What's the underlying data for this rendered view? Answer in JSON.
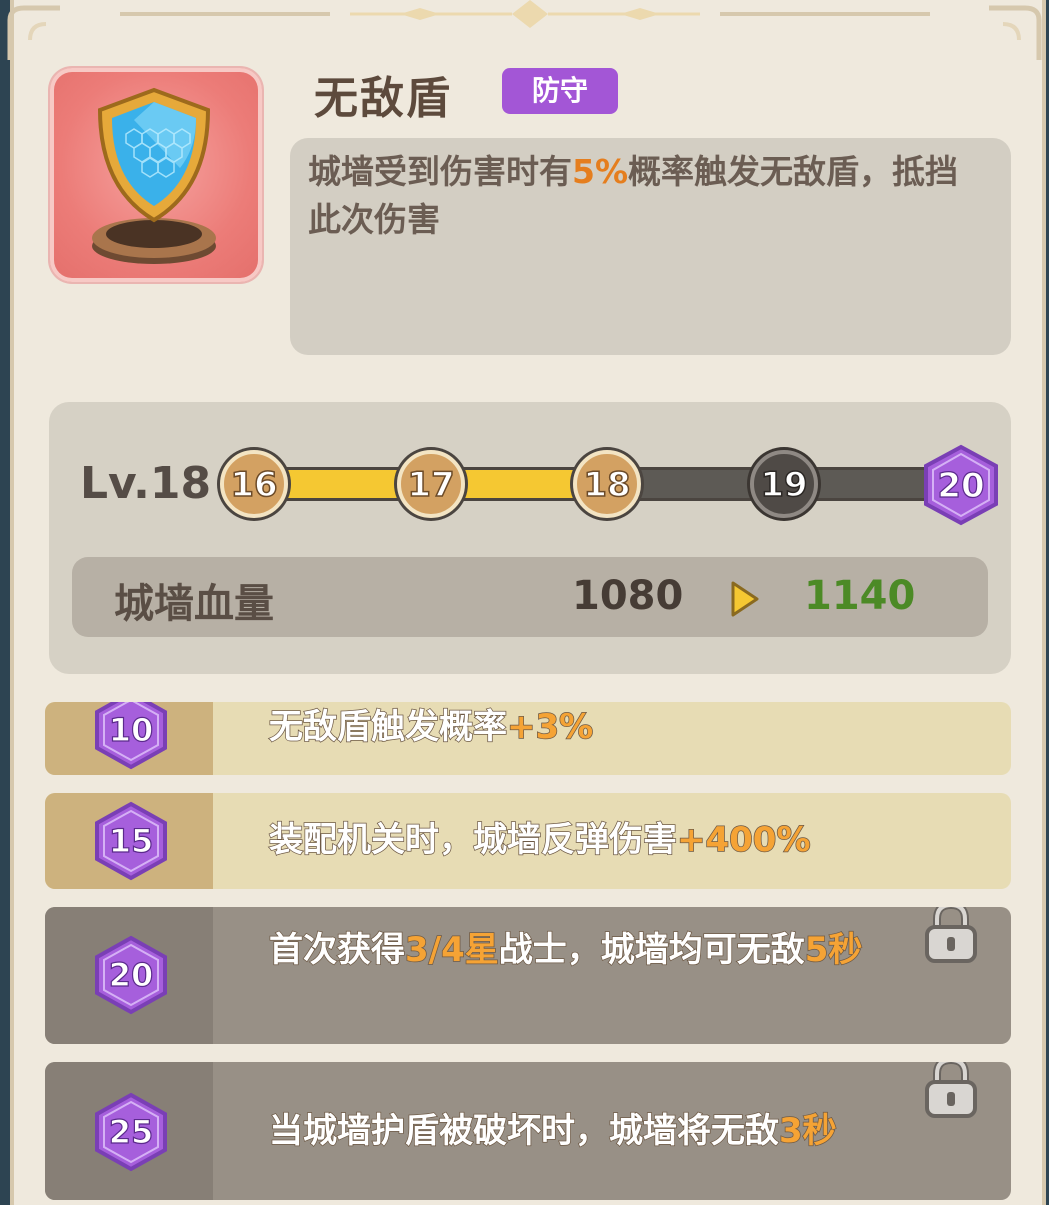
{
  "skill": {
    "name": "无敌盾",
    "tag": "防守",
    "desc_pre": "城墙受到伤害时有",
    "desc_hl": "5%",
    "desc_post": "概率触发无敌盾，抵挡此次伤害"
  },
  "level": {
    "label": "Lv.18",
    "progress": 18,
    "nodes": [
      {
        "label": "16",
        "state": "done"
      },
      {
        "label": "17",
        "state": "done"
      },
      {
        "label": "18",
        "state": "done"
      },
      {
        "label": "19",
        "state": "locked"
      },
      {
        "label": "20",
        "state": "milestone"
      }
    ]
  },
  "stat": {
    "name": "城墙血量",
    "current": "1080",
    "next": "1140"
  },
  "upgrades": [
    {
      "level": "10",
      "pre": "无敌盾触发概率",
      "hl": "+3%",
      "post": "",
      "hl2": "",
      "locked": false
    },
    {
      "level": "15",
      "pre": "装配机关时，城墙反弹伤害",
      "hl": "+400%",
      "post": "",
      "hl2": "",
      "locked": false
    },
    {
      "level": "20",
      "pre": "首次获得",
      "hl": "3/4星",
      "post": "战士，城墙均可无敌",
      "hl2": "5秒",
      "locked": true
    },
    {
      "level": "25",
      "pre": "当城墙护盾被破坏时，城墙将无敌",
      "hl": "3秒",
      "post": "",
      "hl2": "",
      "locked": true
    }
  ],
  "colors": {
    "accent_purple": "#a356d6",
    "highlight_orange": "#e57e1e",
    "next_value_green": "#4c8a26",
    "progress_gold": "#f5c832"
  },
  "icons": [
    "shield-icon",
    "play-arrow-icon",
    "lock-icon"
  ]
}
